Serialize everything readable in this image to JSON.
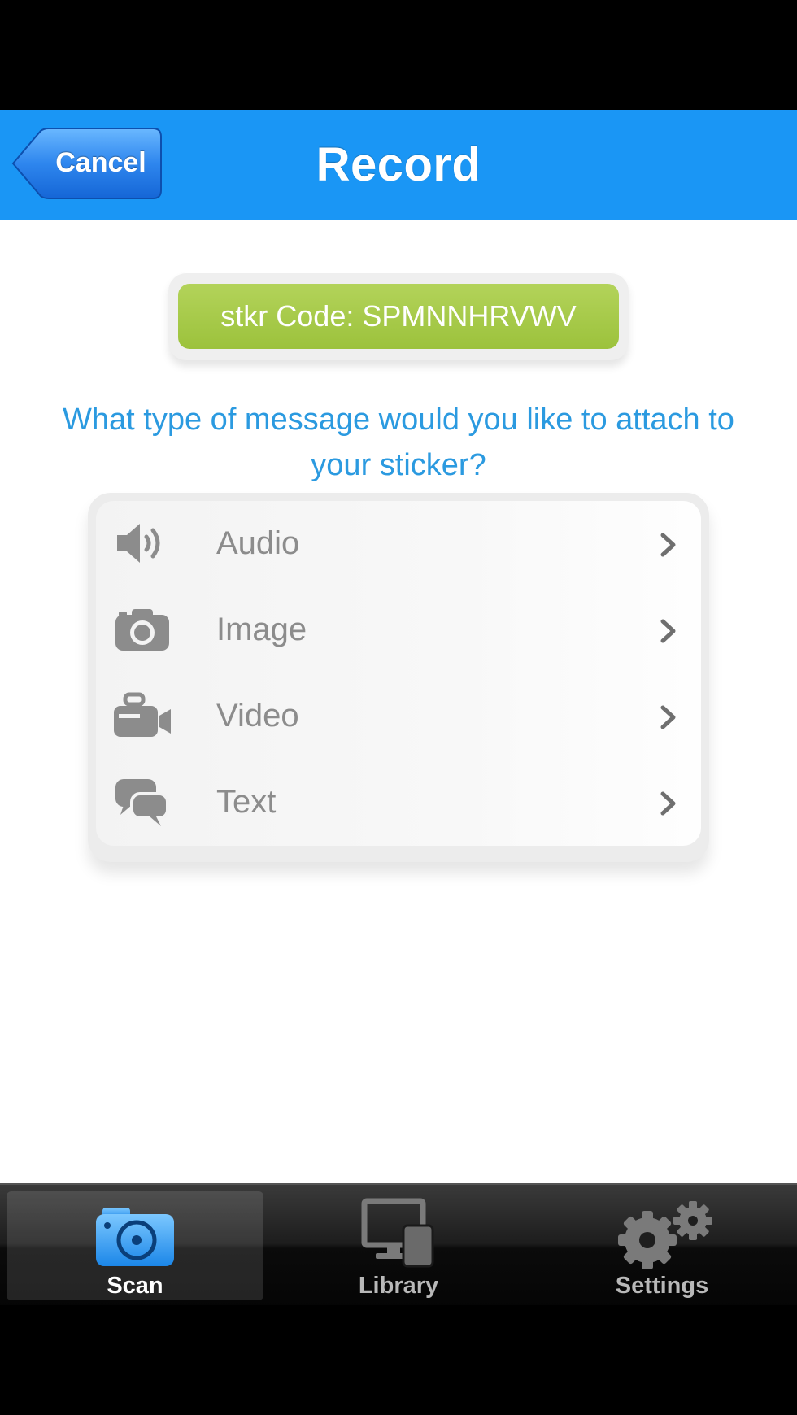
{
  "nav": {
    "title": "Record",
    "cancel_label": "Cancel"
  },
  "code_badge": {
    "text": "stkr Code: SPMNNHRVWV"
  },
  "question": "What type of message would you like to attach to your sticker?",
  "options": [
    {
      "label": "Audio",
      "icon": "speaker-icon"
    },
    {
      "label": "Image",
      "icon": "camera-icon"
    },
    {
      "label": "Video",
      "icon": "video-camera-icon"
    },
    {
      "label": "Text",
      "icon": "chat-bubbles-icon"
    }
  ],
  "tabs": [
    {
      "label": "Scan",
      "icon": "scan-camera-icon",
      "active": true
    },
    {
      "label": "Library",
      "icon": "library-devices-icon",
      "active": false
    },
    {
      "label": "Settings",
      "icon": "gears-icon",
      "active": false
    }
  ],
  "colors": {
    "nav_blue": "#1a96f5",
    "code_green": "#a8cb48",
    "question_blue": "#2b9ae0"
  }
}
